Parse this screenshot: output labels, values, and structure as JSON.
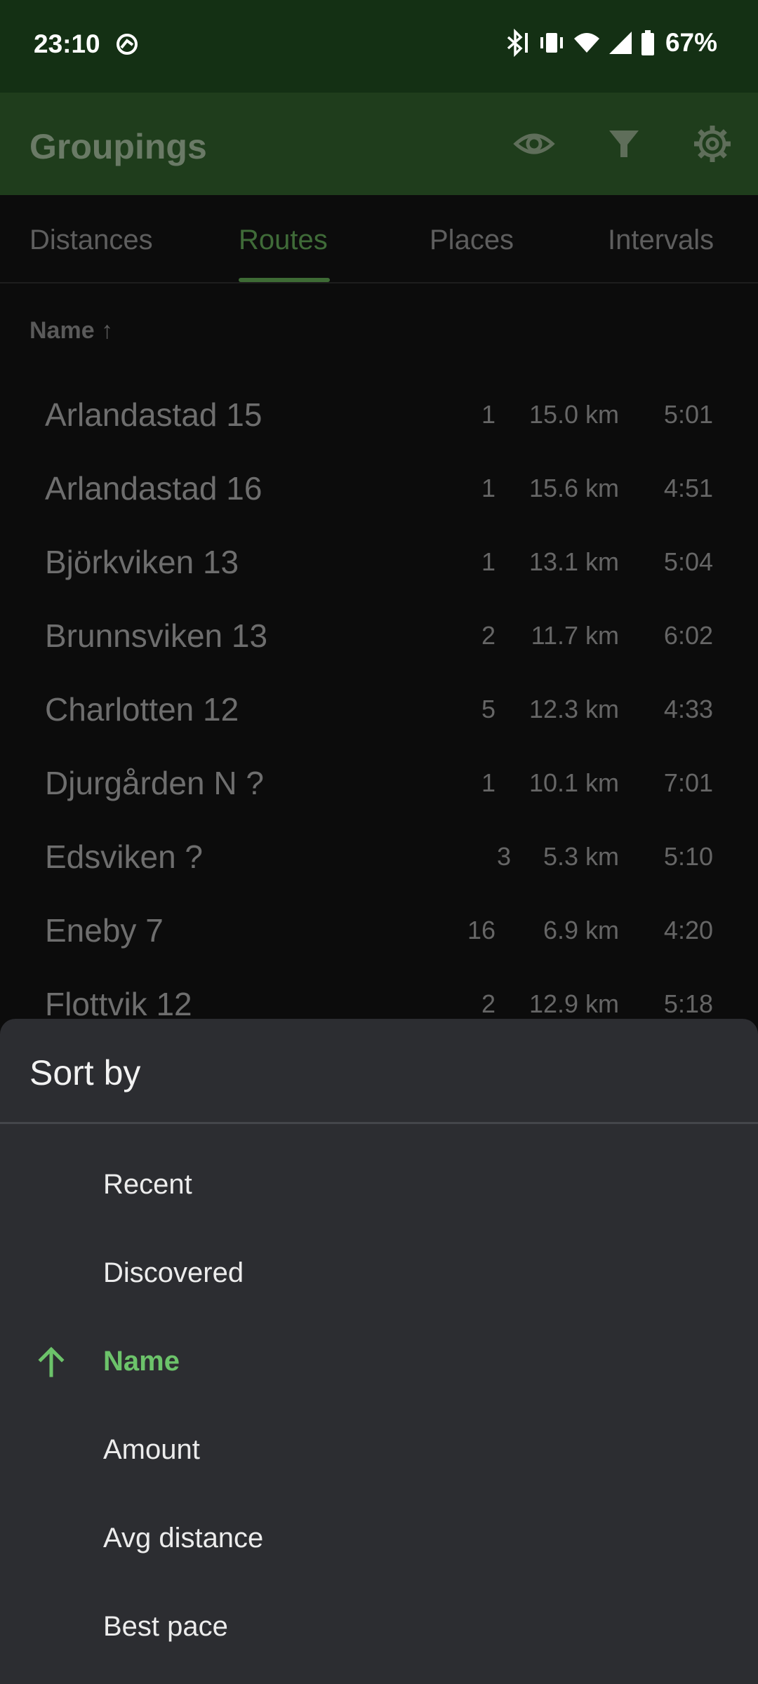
{
  "status_bar": {
    "time": "23:10",
    "battery_percent": "67%",
    "icons": [
      "app-notification-icon",
      "bluetooth-icon",
      "vibrate-icon",
      "wifi-icon",
      "cellular-signal-icon",
      "battery-icon"
    ]
  },
  "app_bar": {
    "title": "Groupings",
    "actions": [
      "eye-icon",
      "filter-icon",
      "gear-icon"
    ]
  },
  "tabs": [
    {
      "label": "Distances",
      "active": false
    },
    {
      "label": "Routes",
      "active": true
    },
    {
      "label": "Places",
      "active": false
    },
    {
      "label": "Intervals",
      "active": false
    }
  ],
  "list": {
    "sort_header": "Name ↑",
    "rows": [
      {
        "name": "Arlandastad 15",
        "count": "1",
        "distance": "15.0 km",
        "pace": "5:01"
      },
      {
        "name": "Arlandastad 16",
        "count": "1",
        "distance": "15.6 km",
        "pace": "4:51"
      },
      {
        "name": "Björkviken 13",
        "count": "1",
        "distance": "13.1 km",
        "pace": "5:04"
      },
      {
        "name": "Brunnsviken 13",
        "count": "2",
        "distance": "11.7 km",
        "pace": "6:02"
      },
      {
        "name": "Charlotten 12",
        "count": "5",
        "distance": "12.3 km",
        "pace": "4:33"
      },
      {
        "name": "Djurgården N ?",
        "count": "1",
        "distance": "10.1 km",
        "pace": "7:01"
      },
      {
        "name": "Edsviken ?",
        "count": "3",
        "distance": "5.3 km",
        "pace": "5:10"
      },
      {
        "name": "Eneby 7",
        "count": "16",
        "distance": "6.9 km",
        "pace": "4:20"
      },
      {
        "name": "Flottvik 12",
        "count": "2",
        "distance": "12.9 km",
        "pace": "5:18"
      }
    ]
  },
  "sort_sheet": {
    "title": "Sort by",
    "options": [
      {
        "label": "Recent",
        "selected": false
      },
      {
        "label": "Discovered",
        "selected": false
      },
      {
        "label": "Name",
        "selected": true,
        "icon": "arrow-up-icon"
      },
      {
        "label": "Amount",
        "selected": false
      },
      {
        "label": "Avg distance",
        "selected": false
      },
      {
        "label": "Best pace",
        "selected": false
      }
    ]
  },
  "colors": {
    "status_bar_bg": "#143014",
    "app_bar_bg": "#1f3d1c",
    "accent_green": "#6cc36a",
    "sheet_bg": "#2c2d31",
    "scrim_bg": "#0c0c0c"
  }
}
